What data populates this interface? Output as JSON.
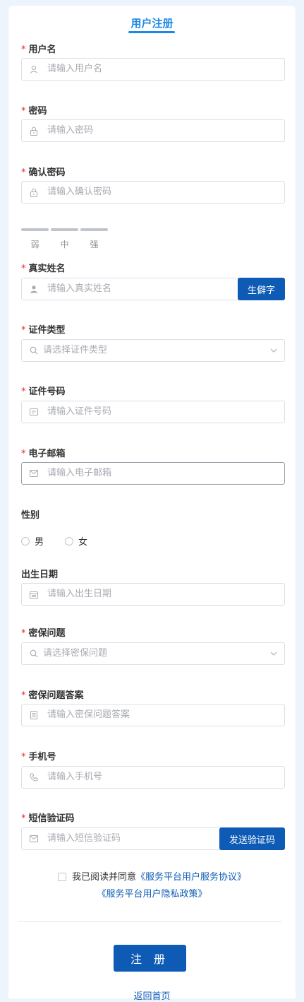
{
  "page_title": "用户注册",
  "fields": {
    "username": {
      "label": "用户名",
      "placeholder": "请输入用户名"
    },
    "password": {
      "label": "密码",
      "placeholder": "请输入密码"
    },
    "confirm_password": {
      "label": "确认密码",
      "placeholder": "请输入确认密码"
    },
    "real_name": {
      "label": "真实姓名",
      "placeholder": "请输入真实姓名",
      "button": "生僻字"
    },
    "id_type": {
      "label": "证件类型",
      "placeholder": "请选择证件类型"
    },
    "id_number": {
      "label": "证件号码",
      "placeholder": "请输入证件号码"
    },
    "email": {
      "label": "电子邮箱",
      "placeholder": "请输入电子邮箱"
    },
    "gender": {
      "label": "性别",
      "options": [
        "男",
        "女"
      ]
    },
    "birth_date": {
      "label": "出生日期",
      "placeholder": "请输入出生日期"
    },
    "security_question": {
      "label": "密保问题",
      "placeholder": "请选择密保问题"
    },
    "security_answer": {
      "label": "密保问题答案",
      "placeholder": "请输入密保问题答案"
    },
    "phone": {
      "label": "手机号",
      "placeholder": "请输入手机号"
    },
    "sms_code": {
      "label": "短信验证码",
      "placeholder": "请输入短信验证码",
      "button": "发送验证码"
    }
  },
  "required_mark": "*",
  "strength": [
    "弱",
    "中",
    "强"
  ],
  "agreement": {
    "prefix": "我已阅读并同意",
    "service_link": "《服务平台用户服务协议》",
    "privacy_link": "《服务平台用户隐私政策》"
  },
  "submit_label": "注 册",
  "home_link": "返回首页",
  "colors": {
    "accent": "#1e88e5",
    "primary": "#0d5bb5",
    "required": "#f5222d"
  }
}
